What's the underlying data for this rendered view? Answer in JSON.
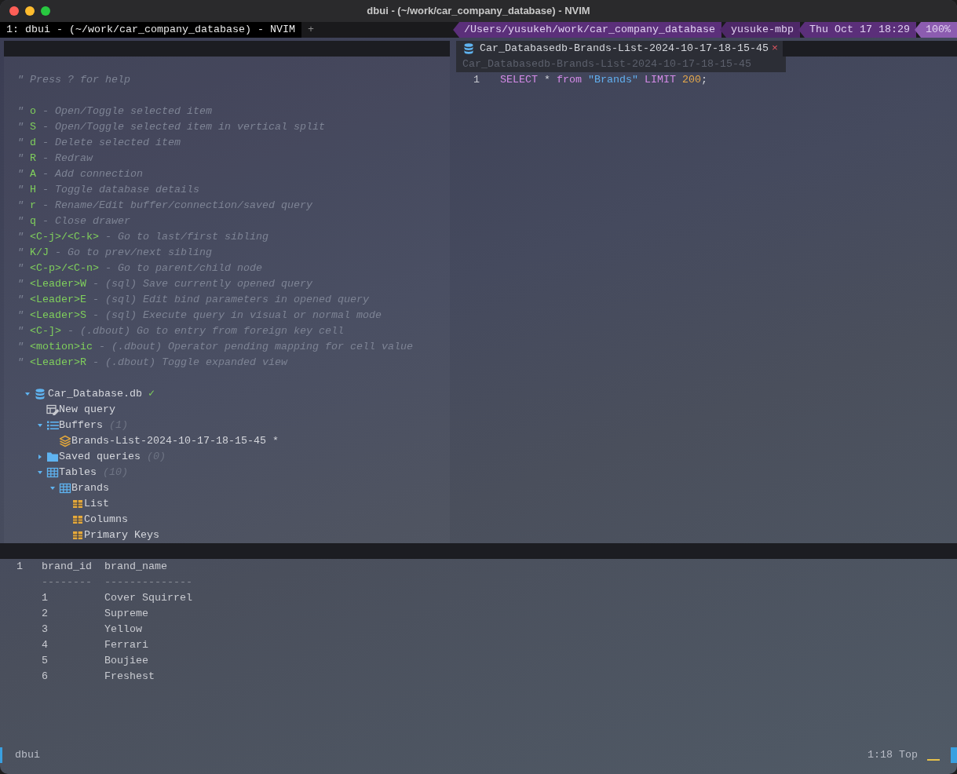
{
  "window": {
    "title": "dbui - (~/work/car_company_database) - NVIM"
  },
  "tmux": {
    "windows": [
      {
        "label": "1: dbui - (~/work/car_company_database) - NVIM",
        "selected": true
      },
      {
        "label": "+",
        "selected": false
      }
    ],
    "status": [
      "/Users/yusukeh/work/car_company_database",
      "yusuke-mbp",
      "Thu Oct 17 18:29",
      "100%"
    ]
  },
  "drawer": {
    "comment_mark": "\"",
    "help": [
      {
        "text": "Press ? for help"
      },
      {
        "key": "o",
        "text": "- Open/Toggle selected item"
      },
      {
        "key": "S",
        "text": "- Open/Toggle selected item in vertical split"
      },
      {
        "key": "d",
        "text": "- Delete selected item"
      },
      {
        "key": "R",
        "text": "- Redraw"
      },
      {
        "key": "A",
        "text": "- Add connection"
      },
      {
        "key": "H",
        "text": "- Toggle database details"
      },
      {
        "key": "r",
        "text": "- Rename/Edit buffer/connection/saved query"
      },
      {
        "key": "q",
        "text": "- Close drawer"
      },
      {
        "key": "<C-j>/<C-k>",
        "text": "- Go to last/first sibling"
      },
      {
        "key": "K/J",
        "text": "- Go to prev/next sibling"
      },
      {
        "key": "<C-p>/<C-n>",
        "text": "- Go to parent/child node"
      },
      {
        "key": "<Leader>W",
        "text": "- (sql) Save currently opened query"
      },
      {
        "key": "<Leader>E",
        "text": "- (sql) Edit bind parameters in opened query"
      },
      {
        "key": "<Leader>S",
        "text": "- (sql) Execute query in visual or normal mode"
      },
      {
        "key": "<C-]>",
        "text": "- (.dbout) Go to entry from foreign key cell"
      },
      {
        "key": "<motion>ic",
        "text": "- (.dbout) Operator pending mapping for cell value"
      },
      {
        "key": "<Leader>R",
        "text": "- (.dbout) Toggle expanded view"
      }
    ],
    "tree": [
      {
        "label": "Car_Database.db",
        "kind": "database",
        "expanded": true,
        "status": "✓",
        "children": [
          {
            "label": "New query",
            "kind": "new-query"
          },
          {
            "label": "Buffers",
            "kind": "list",
            "count": "(1)",
            "expanded": true,
            "children": [
              {
                "label": "Brands-List-2024-10-17-18-15-45",
                "kind": "layers",
                "suffix": "*"
              }
            ]
          },
          {
            "label": "Saved queries",
            "kind": "folder",
            "count": "(0)",
            "expanded": false
          },
          {
            "label": "Tables",
            "kind": "table",
            "count": "(10)",
            "expanded": true,
            "children": [
              {
                "label": "Brands",
                "kind": "table",
                "expanded": true,
                "children": [
                  {
                    "label": "List",
                    "kind": "small-table"
                  },
                  {
                    "label": "Columns",
                    "kind": "small-table"
                  },
                  {
                    "label": "Primary Keys",
                    "kind": "small-table"
                  }
                ]
              }
            ]
          }
        ]
      }
    ]
  },
  "editor": {
    "tab": {
      "label": "Car_Databasedb-Brands-List-2024-10-17-18-15-45",
      "close": "×"
    },
    "winbar": "Car_Databasedb-Brands-List-2024-10-17-18-15-45",
    "lines": [
      {
        "number": "1",
        "tokens": [
          {
            "kind": "keyword",
            "text": "SELECT"
          },
          {
            "kind": "plain",
            "text": " * "
          },
          {
            "kind": "keyword",
            "text": "from"
          },
          {
            "kind": "string",
            "text": " \"Brands\""
          },
          {
            "kind": "keyword",
            "text": " LIMIT"
          },
          {
            "kind": "number",
            "text": " 200"
          },
          {
            "kind": "plain",
            "text": ";"
          }
        ]
      }
    ]
  },
  "results": {
    "line_number": "1",
    "columns": [
      "brand_id",
      "brand_name"
    ],
    "separators": [
      "--------",
      "--------------"
    ],
    "rows": [
      [
        "1",
        "Cover Squirrel"
      ],
      [
        "2",
        "Supreme"
      ],
      [
        "3",
        "Yellow"
      ],
      [
        "4",
        "Ferrari"
      ],
      [
        "5",
        "Boujiee"
      ],
      [
        "6",
        "Freshest"
      ]
    ]
  },
  "statusline": {
    "name": "dbui",
    "position": "1:18 Top"
  }
}
